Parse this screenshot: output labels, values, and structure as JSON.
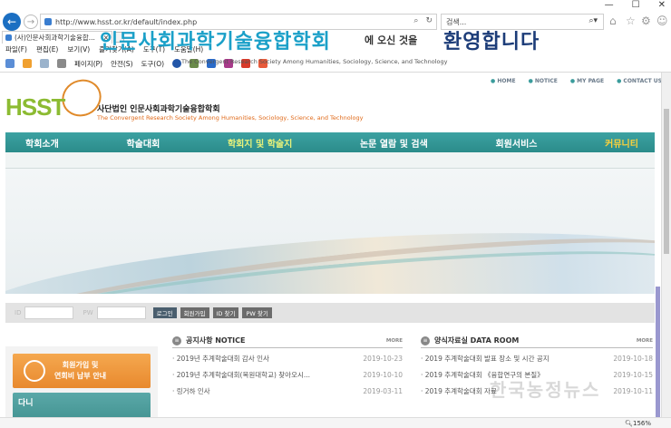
{
  "browser": {
    "url": "http://www.hsst.or.kr/default/index.php",
    "search_placeholder": "검색...",
    "tab_title": "(사)인문사회과학기술융합..."
  },
  "menubar": [
    "파일(F)",
    "편집(E)",
    "보기(V)",
    "즐겨찾기(A)",
    "도구(T)",
    "도움말(H)"
  ],
  "cmdbar": [
    "페이지(P)",
    "안전(S)",
    "도구(O)"
  ],
  "page": {
    "util_links": [
      "HOME",
      "NOTICE",
      "MY PAGE",
      "CONTACT US"
    ],
    "logo": "HSST",
    "org_name": "사단법인 인문사회과학기술융합학회",
    "org_en": "The Convergent Research Society Among Humanities, Sociology, Science, and Technology",
    "nav": [
      "학회소개",
      "학술대회",
      "학회지 및 학술지",
      "논문 열람 및 검색",
      "회원서비스",
      "커뮤니티"
    ],
    "banner": {
      "title": "인문사회과학기술융합학회",
      "mid": "에 오신 것을",
      "welcome": "환영합니다",
      "en": "The Convergent Research Society Among Humanities, Sociology, Science, and Technology"
    },
    "login": {
      "id_label": "ID",
      "pw_label": "PW",
      "login_btn": "로그인",
      "join_btn": "회원가입",
      "find_id": "ID 찾기",
      "find_pw": "PW 찾기"
    },
    "join_box": {
      "line1": "회원가입 및",
      "line2": "연회비 납부 안내"
    },
    "about_box": "다니",
    "notice": {
      "title": "공지사항 NOTICE",
      "more": "MORE",
      "rows": [
        {
          "t": "· 2019년 추계학술대회 감사 인사",
          "d": "2019-10-23"
        },
        {
          "t": "· 2019년 추계학술대회(목원대학교) 찾아오시...",
          "d": "2019-10-10"
        },
        {
          "t": "· 링거하 인사",
          "d": "2019-03-11"
        }
      ]
    },
    "dataroom": {
      "title": "양식자료실 DATA ROOM",
      "more": "MORE",
      "rows": [
        {
          "t": "· 2019 추계학술대회 발표 장소 및 시간 공지",
          "d": "2019-10-18"
        },
        {
          "t": "· 2019 추계학술대회 《융합연구의 본질》",
          "d": "2019-10-15"
        },
        {
          "t": "· 2019 추계학술대회 자료",
          "d": "2019-10-11"
        }
      ]
    }
  },
  "watermark": "한국농정뉴스",
  "status": {
    "zoom": "156%"
  }
}
